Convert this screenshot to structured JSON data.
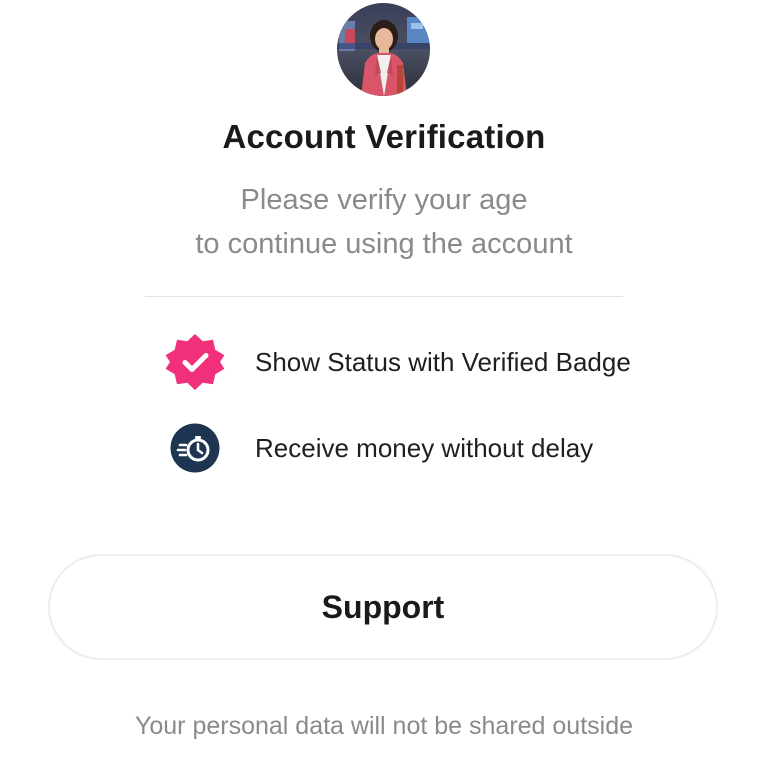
{
  "header": {
    "avatar_icon": "profile-photo",
    "title": "Account Verification",
    "subtitle_line1": "Please verify your age",
    "subtitle_line2": "to continue using the account"
  },
  "features": [
    {
      "icon": "verified-badge-icon",
      "icon_color": "#f0307a",
      "label": "Show Status with Verified Badge"
    },
    {
      "icon": "stopwatch-icon",
      "icon_color": "#1d3550",
      "label": "Receive money without delay"
    }
  ],
  "actions": {
    "support_label": "Support"
  },
  "footer": {
    "note": "Your personal data will not be shared outside"
  }
}
